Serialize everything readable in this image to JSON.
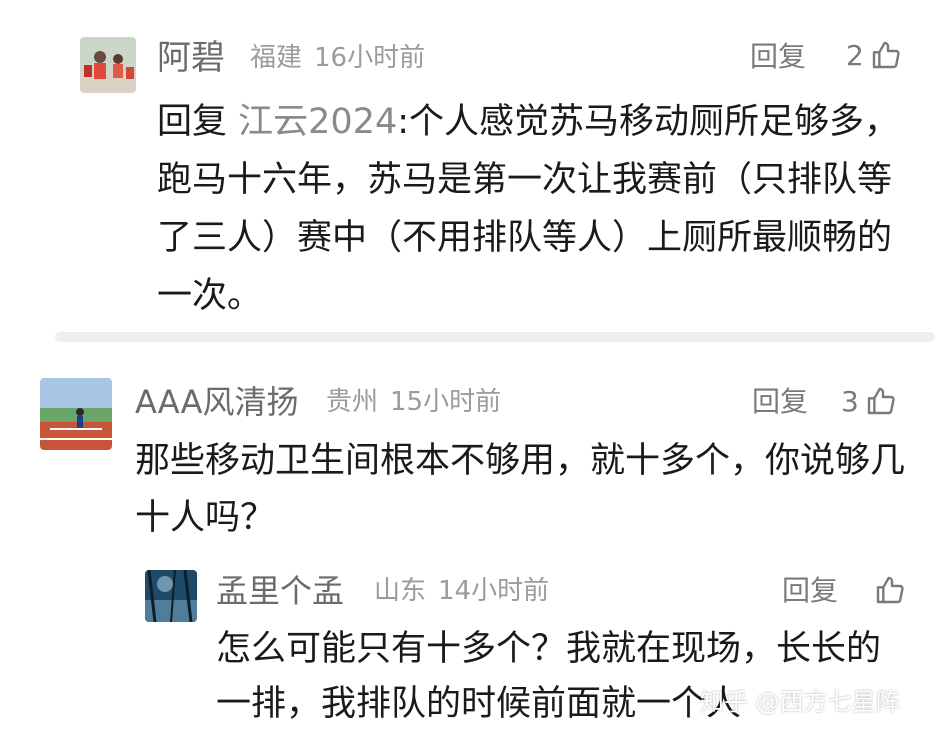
{
  "comments": [
    {
      "name": "阿碧",
      "location": "福建",
      "time": "16小时前",
      "reply_label": "回复",
      "likes": "2",
      "reply_prefix": "回复",
      "mention": "江云2024",
      "text": "个人感觉苏马移动厕所足够多，跑马十六年，苏马是第一次让我赛前（只排队等了三人）赛中（不用排队等人）上厕所最顺畅的一次。"
    },
    {
      "name": "AAA风清扬",
      "location": "贵州",
      "time": "15小时前",
      "reply_label": "回复",
      "likes": "3",
      "text": "那些移动卫生间根本不够用，就十多个，你说够几十人吗？"
    },
    {
      "name": "孟里个孟",
      "location": "山东",
      "time": "14小时前",
      "reply_label": "回复",
      "likes": "",
      "text": "怎么可能只有十多个？我就在现场，长长的一排，我排队的时候前面就一个人"
    }
  ],
  "watermark": "知乎 @西方七星阵",
  "icons": {
    "like": "thumbs-up-icon"
  },
  "colors": {
    "text": "#1a1a1a",
    "name": "#6b6b6b",
    "meta": "#9b9b9b",
    "divider": "#eeeeee"
  }
}
